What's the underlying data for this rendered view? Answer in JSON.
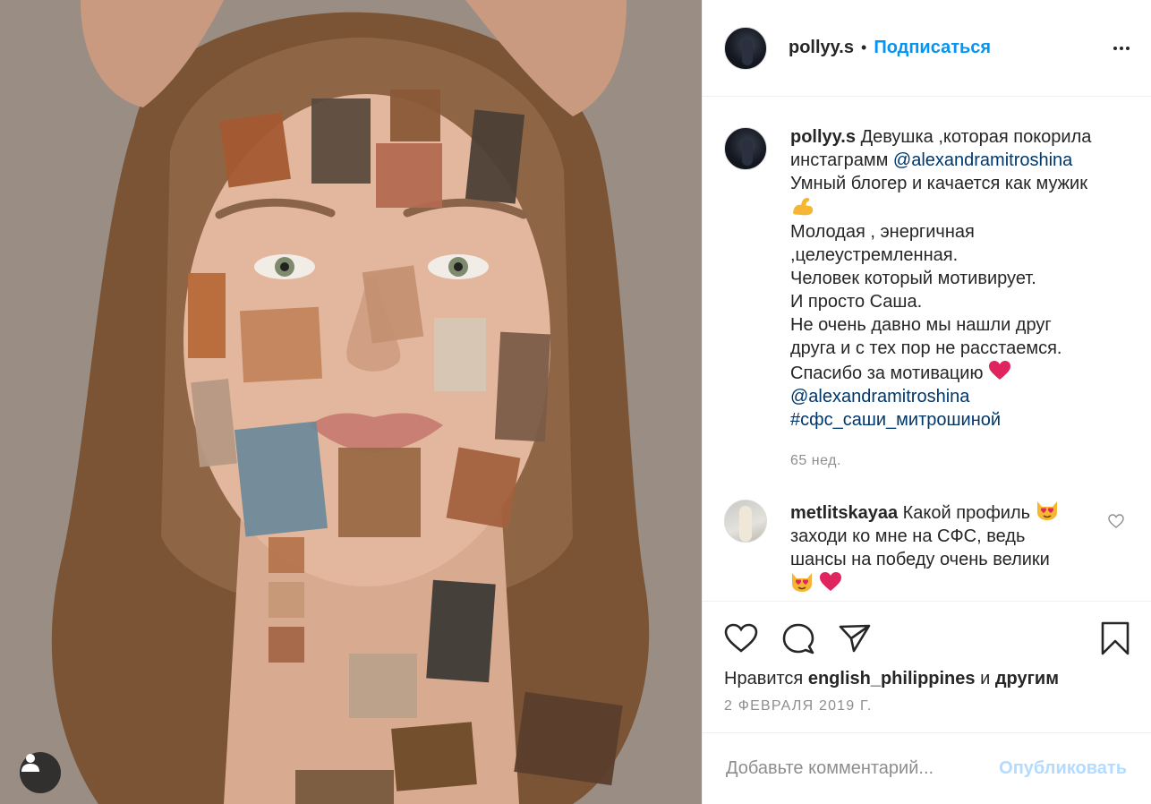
{
  "post": {
    "username": "pollyy.s",
    "follow_label": "Подписаться",
    "separator": "•"
  },
  "caption": {
    "username": "pollyy.s",
    "lines": [
      "Девушка ,которая покорила",
      "инстаграмм",
      "@alexandramitroshina",
      "Умный блогер и качается как мужик",
      "Молодая , энергичная",
      ",целеустремленная.",
      "Человек который мотивирует.",
      "И просто Саша.",
      "Не очень давно мы нашли друг",
      "друга и с тех пор не расстаемся.",
      "Спасибо за мотивацию",
      "@alexandramitroshina",
      "#сфс_саши_митрошиной"
    ],
    "time_ago": "65 нед."
  },
  "comment": {
    "username": "metlitskayaa",
    "line1": "Какой профиль",
    "line2": "заходи ко мне на СФС, ведь",
    "line3": "шансы на победу очень велики"
  },
  "likes": {
    "prefix": "Нравится",
    "user": "english_philippines",
    "conj": "и",
    "others": "другим"
  },
  "date": "2 ФЕВРАЛЯ 2019 Г.",
  "add_comment": {
    "placeholder": "Добавьте комментарий...",
    "post_label": "Опубликовать"
  },
  "icons": {
    "like": "heart-icon",
    "comment": "comment-icon",
    "share": "share-icon",
    "save": "bookmark-icon",
    "more": "more-icon",
    "tagged": "user-tag-icon"
  },
  "colors": {
    "link_blue": "#0095f6",
    "mention": "#00376b",
    "muted": "#8e8e8e",
    "post_disabled": "#b3dbff",
    "heart_red": "#e0245e"
  }
}
